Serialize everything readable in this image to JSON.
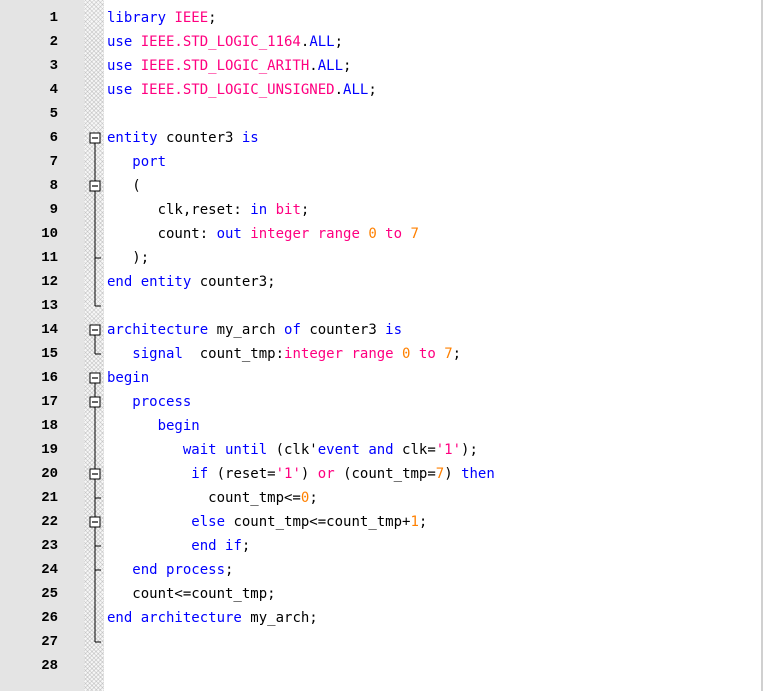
{
  "editor": {
    "language": "VHDL",
    "lines": [
      [
        {
          "t": "library ",
          "c": "kw"
        },
        {
          "t": "IEEE",
          "c": "lib"
        },
        {
          "t": ";",
          "c": "plain"
        }
      ],
      [
        {
          "t": "use ",
          "c": "kw"
        },
        {
          "t": "IEEE.STD_LOGIC_1164",
          "c": "lib"
        },
        {
          "t": ".",
          "c": "plain"
        },
        {
          "t": "ALL",
          "c": "kw"
        },
        {
          "t": ";",
          "c": "plain"
        }
      ],
      [
        {
          "t": "use ",
          "c": "kw"
        },
        {
          "t": "IEEE.STD_LOGIC_ARITH",
          "c": "lib"
        },
        {
          "t": ".",
          "c": "plain"
        },
        {
          "t": "ALL",
          "c": "kw"
        },
        {
          "t": ";",
          "c": "plain"
        }
      ],
      [
        {
          "t": "use ",
          "c": "kw"
        },
        {
          "t": "IEEE.STD_LOGIC_UNSIGNED",
          "c": "lib"
        },
        {
          "t": ".",
          "c": "plain"
        },
        {
          "t": "ALL",
          "c": "kw"
        },
        {
          "t": ";",
          "c": "plain"
        }
      ],
      [],
      [
        {
          "t": "entity ",
          "c": "kw"
        },
        {
          "t": "counter3 ",
          "c": "plain"
        },
        {
          "t": "is",
          "c": "kw"
        }
      ],
      [
        {
          "t": "   ",
          "c": "plain"
        },
        {
          "t": "port",
          "c": "kw"
        }
      ],
      [
        {
          "t": "   (",
          "c": "plain"
        }
      ],
      [
        {
          "t": "      clk,reset: ",
          "c": "plain"
        },
        {
          "t": "in ",
          "c": "kw"
        },
        {
          "t": "bit",
          "c": "lib"
        },
        {
          "t": ";",
          "c": "plain"
        }
      ],
      [
        {
          "t": "      count: ",
          "c": "plain"
        },
        {
          "t": "out ",
          "c": "kw"
        },
        {
          "t": "integer range ",
          "c": "lib"
        },
        {
          "t": "0 ",
          "c": "num"
        },
        {
          "t": "to ",
          "c": "lib"
        },
        {
          "t": "7",
          "c": "num"
        }
      ],
      [
        {
          "t": "   );",
          "c": "plain"
        }
      ],
      [
        {
          "t": "end entity ",
          "c": "kw"
        },
        {
          "t": "counter3;",
          "c": "plain"
        }
      ],
      [],
      [
        {
          "t": "architecture ",
          "c": "kw"
        },
        {
          "t": "my_arch ",
          "c": "plain"
        },
        {
          "t": "of ",
          "c": "kw"
        },
        {
          "t": "counter3 ",
          "c": "plain"
        },
        {
          "t": "is",
          "c": "kw"
        }
      ],
      [
        {
          "t": "   ",
          "c": "plain"
        },
        {
          "t": "signal  ",
          "c": "kw"
        },
        {
          "t": "count_tmp:",
          "c": "plain"
        },
        {
          "t": "integer range ",
          "c": "lib"
        },
        {
          "t": "0 ",
          "c": "num"
        },
        {
          "t": "to ",
          "c": "lib"
        },
        {
          "t": "7",
          "c": "num"
        },
        {
          "t": ";",
          "c": "plain"
        }
      ],
      [
        {
          "t": "begin",
          "c": "kw"
        }
      ],
      [
        {
          "t": "   ",
          "c": "plain"
        },
        {
          "t": "process",
          "c": "kw"
        }
      ],
      [
        {
          "t": "      ",
          "c": "plain"
        },
        {
          "t": "begin",
          "c": "kw"
        }
      ],
      [
        {
          "t": "         ",
          "c": "plain"
        },
        {
          "t": "wait until ",
          "c": "kw"
        },
        {
          "t": "(clk'",
          "c": "plain"
        },
        {
          "t": "event ",
          "c": "kw"
        },
        {
          "t": "and ",
          "c": "kw"
        },
        {
          "t": "clk=",
          "c": "plain"
        },
        {
          "t": "'1'",
          "c": "lib"
        },
        {
          "t": ");",
          "c": "plain"
        }
      ],
      [
        {
          "t": "          ",
          "c": "plain"
        },
        {
          "t": "if ",
          "c": "kw"
        },
        {
          "t": "(reset=",
          "c": "plain"
        },
        {
          "t": "'1'",
          "c": "lib"
        },
        {
          "t": ") ",
          "c": "plain"
        },
        {
          "t": "or ",
          "c": "lib"
        },
        {
          "t": "(count_tmp=",
          "c": "plain"
        },
        {
          "t": "7",
          "c": "num"
        },
        {
          "t": ") ",
          "c": "plain"
        },
        {
          "t": "then",
          "c": "kw"
        }
      ],
      [
        {
          "t": "            count_tmp<=",
          "c": "plain"
        },
        {
          "t": "0",
          "c": "num"
        },
        {
          "t": ";",
          "c": "plain"
        }
      ],
      [
        {
          "t": "          ",
          "c": "plain"
        },
        {
          "t": "else ",
          "c": "kw"
        },
        {
          "t": "count_tmp<=count_tmp+",
          "c": "plain"
        },
        {
          "t": "1",
          "c": "num"
        },
        {
          "t": ";",
          "c": "plain"
        }
      ],
      [
        {
          "t": "          ",
          "c": "plain"
        },
        {
          "t": "end if",
          "c": "kw"
        },
        {
          "t": ";",
          "c": "plain"
        }
      ],
      [
        {
          "t": "   ",
          "c": "plain"
        },
        {
          "t": "end process",
          "c": "kw"
        },
        {
          "t": ";",
          "c": "plain"
        }
      ],
      [
        {
          "t": "   count<=count_tmp;",
          "c": "plain"
        }
      ],
      [
        {
          "t": "end architecture ",
          "c": "kw"
        },
        {
          "t": "my_arch;",
          "c": "plain"
        }
      ],
      [],
      []
    ]
  },
  "colors": {
    "keyword": "#0000ff",
    "library": "#ff0080",
    "number": "#ff8000",
    "gutter": "#e4e4e4",
    "fold_marker": "#000000"
  },
  "fold_markers": [
    "minus-box-icon",
    "fold-line",
    "fold-end-icon",
    "fold-branch-icon"
  ]
}
